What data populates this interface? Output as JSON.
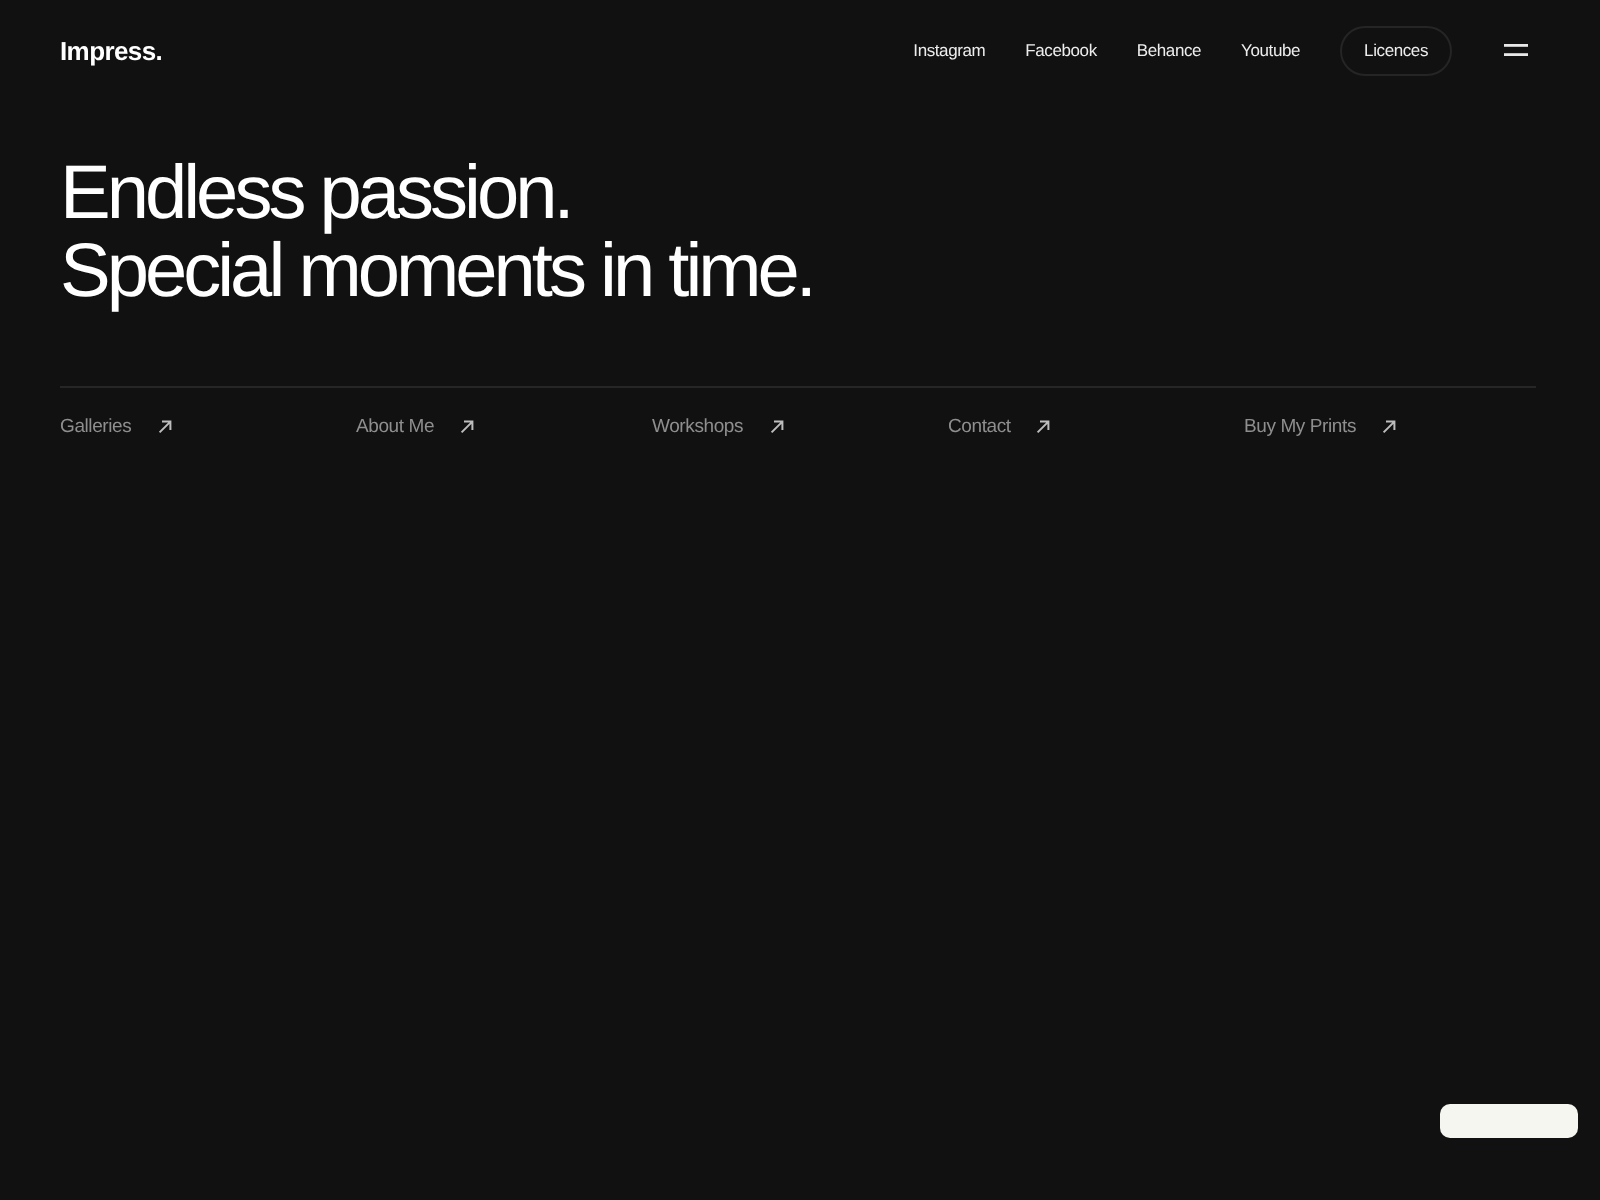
{
  "header": {
    "logo": "Impress.",
    "social_links": [
      "Instagram",
      "Facebook",
      "Behance",
      "Youtube"
    ],
    "licences_button": "Licences"
  },
  "hero": {
    "heading_lines": [
      "Endless passion.",
      "Special moments in time."
    ]
  },
  "links": [
    {
      "label": "Galleries"
    },
    {
      "label": "About Me"
    },
    {
      "label": "Workshops"
    },
    {
      "label": "Contact"
    },
    {
      "label": "Buy My Prints"
    }
  ]
}
